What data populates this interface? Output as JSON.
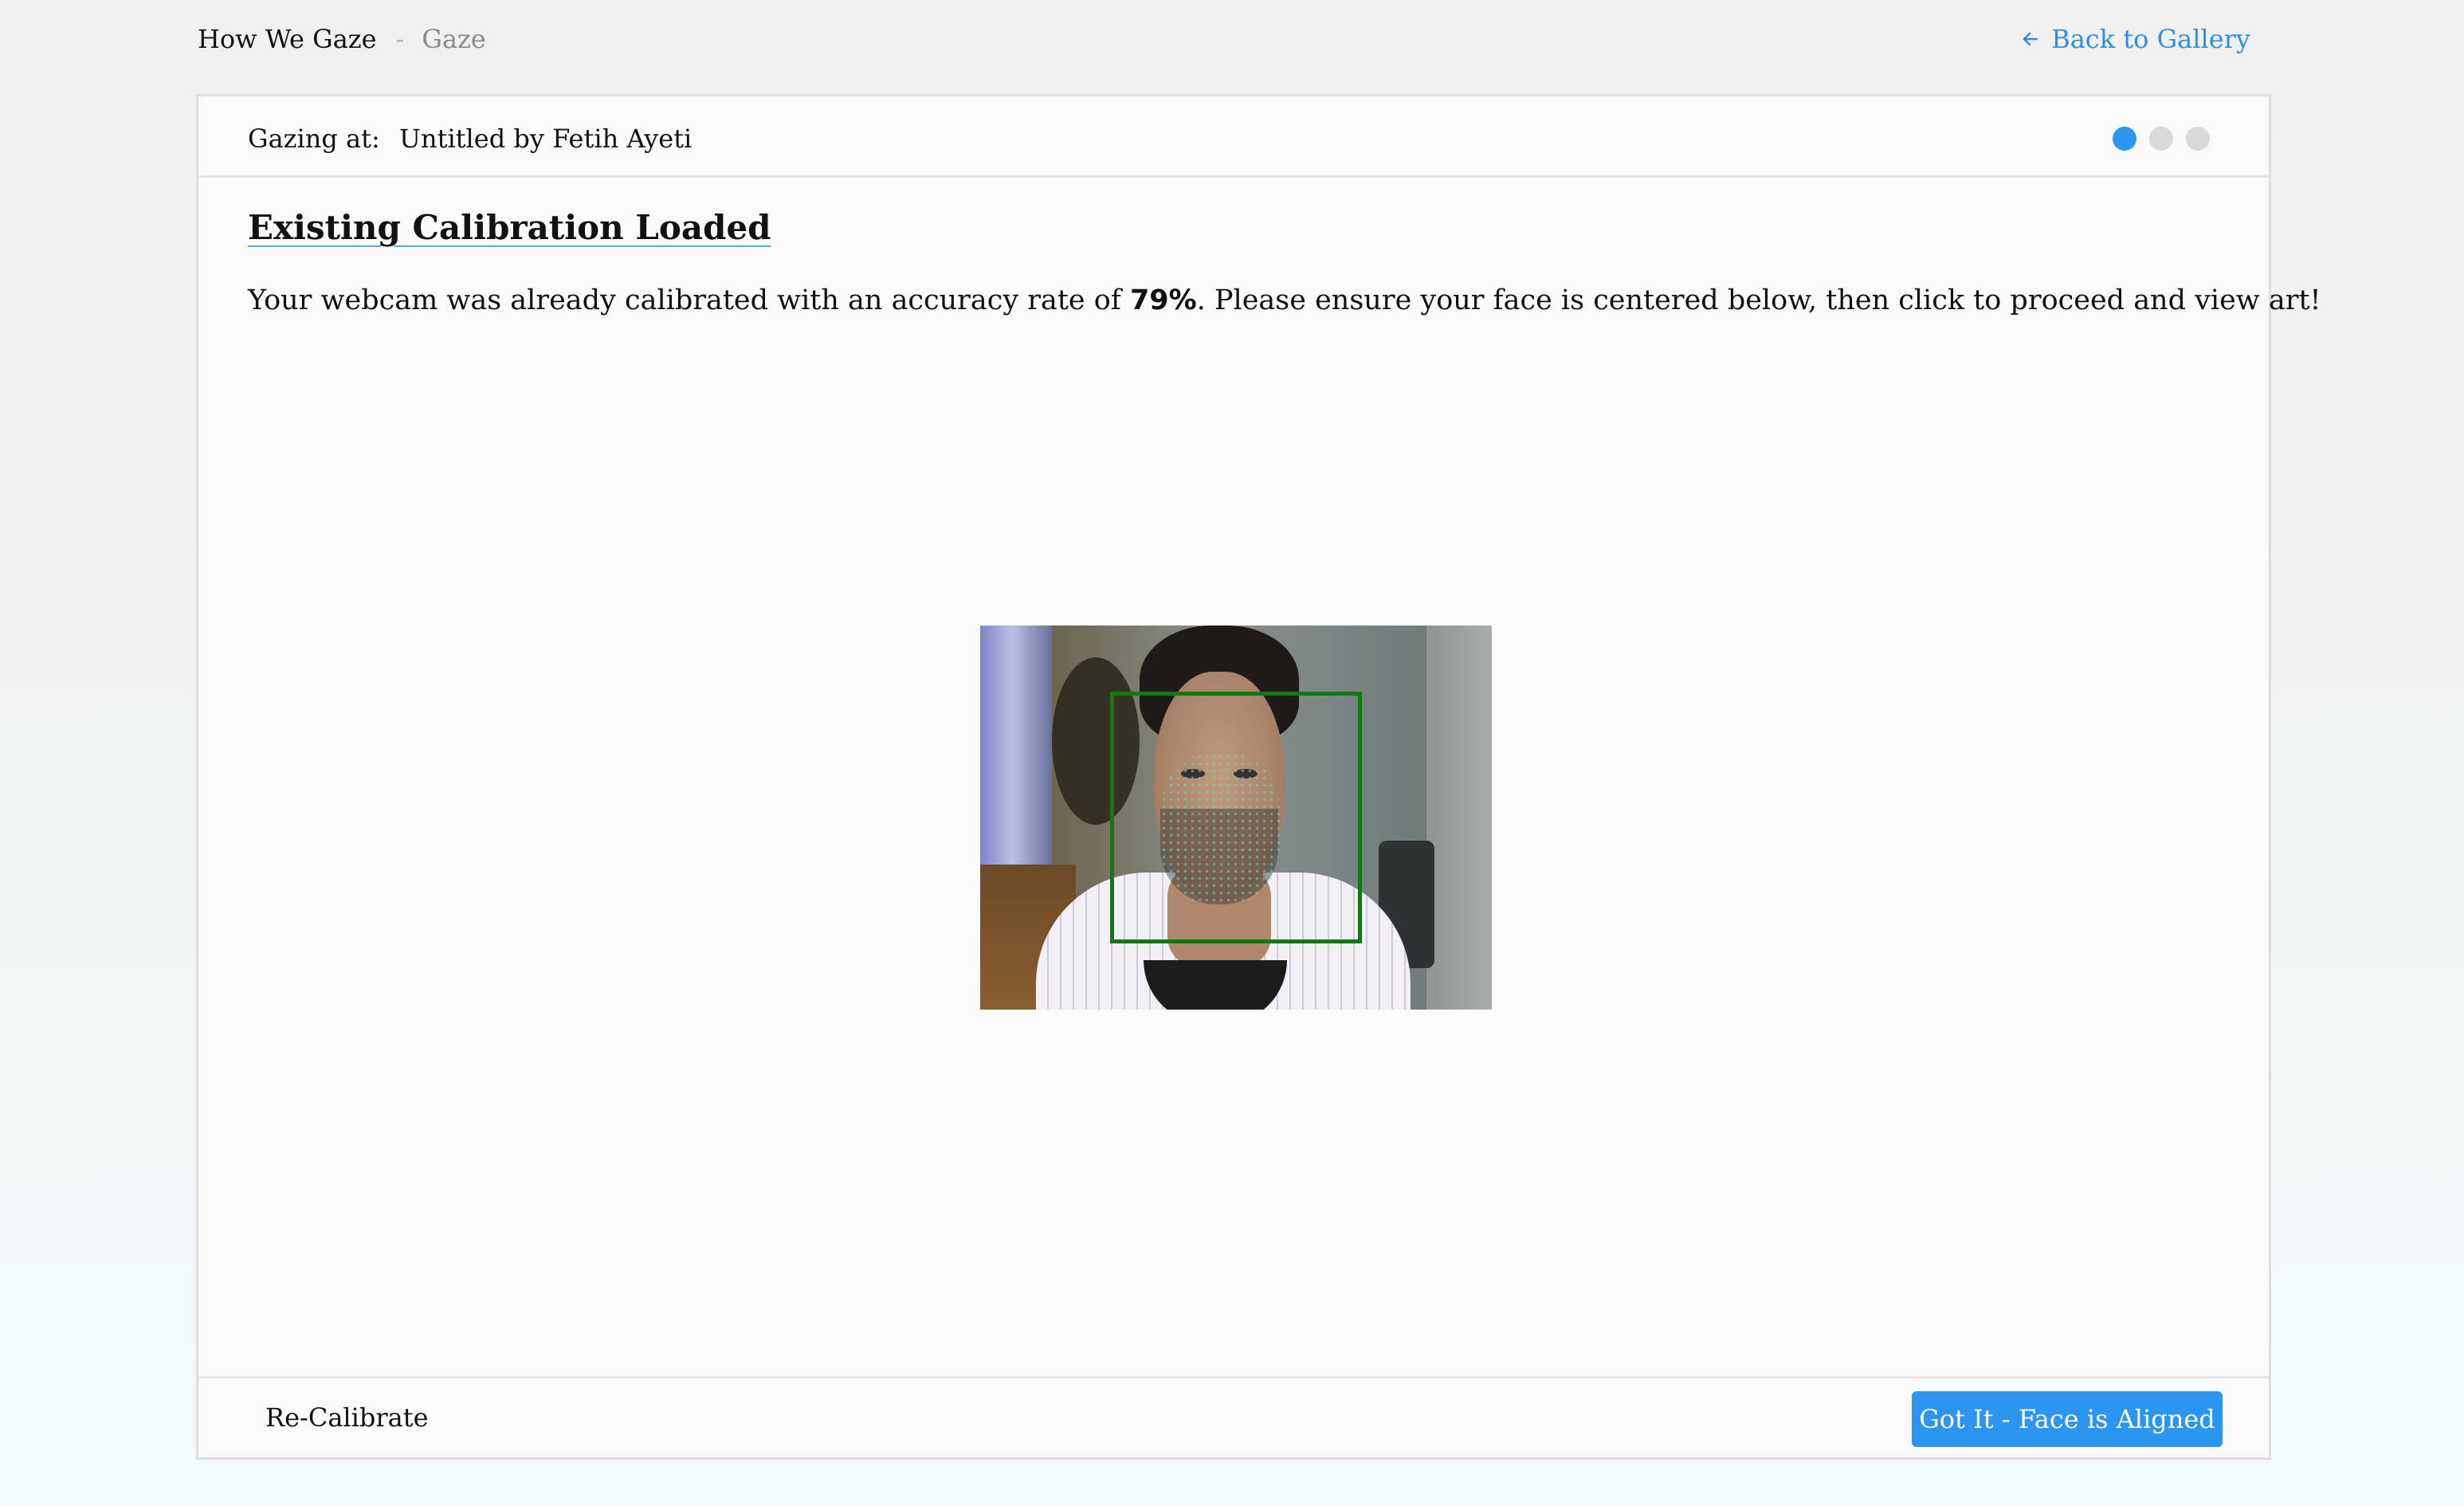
{
  "header": {
    "brand": "How We Gaze",
    "separator": "-",
    "section": "Gaze",
    "back_label": "Back to Gallery",
    "back_icon": "arrow-left-icon"
  },
  "card": {
    "gazing_label": "Gazing at:",
    "gazing_title": "Untitled by Fetih Ayeti",
    "progress": {
      "current_step": 1,
      "total_steps": 3
    },
    "heading": "Existing Calibration Loaded",
    "desc_before": "Your webcam was already calibrated with an accuracy rate of ",
    "accuracy": "79%",
    "desc_after": ". Please ensure your face is centered below, then click to proceed and view art!"
  },
  "footer": {
    "recalibrate_label": "Re-Calibrate",
    "proceed_label": "Got It - Face is Aligned"
  },
  "colors": {
    "accent": "#2b95f0",
    "link": "#2b8fe6",
    "face_box": "#0f7a12",
    "dot_inactive": "#d9d9d9"
  }
}
